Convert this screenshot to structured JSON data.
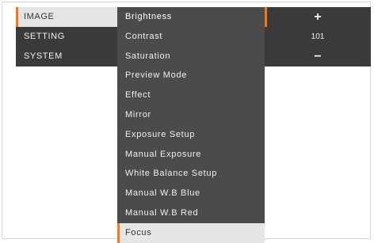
{
  "main_menu": {
    "items": [
      {
        "label": "IMAGE"
      },
      {
        "label": "SETTING"
      },
      {
        "label": "SYSTEM"
      }
    ]
  },
  "sub_menu": {
    "items": [
      {
        "label": "Brightness"
      },
      {
        "label": "Contrast"
      },
      {
        "label": "Saturation"
      },
      {
        "label": "Preview Mode"
      },
      {
        "label": "Effect"
      },
      {
        "label": "Mirror"
      },
      {
        "label": "Exposure Setup"
      },
      {
        "label": "Manual Exposure"
      },
      {
        "label": "White Balance Setup"
      },
      {
        "label": "Manual W.B Blue"
      },
      {
        "label": "Manual W.B Red"
      },
      {
        "label": "Focus"
      }
    ]
  },
  "value_panel": {
    "increase_symbol": "+",
    "value": "101",
    "decrease_symbol": "−"
  },
  "colors": {
    "accent": "#f07a24",
    "menu_bg": "#3a3a3a",
    "submenu_bg": "#4b4b4b",
    "selected_bg": "#e4e4e4"
  }
}
